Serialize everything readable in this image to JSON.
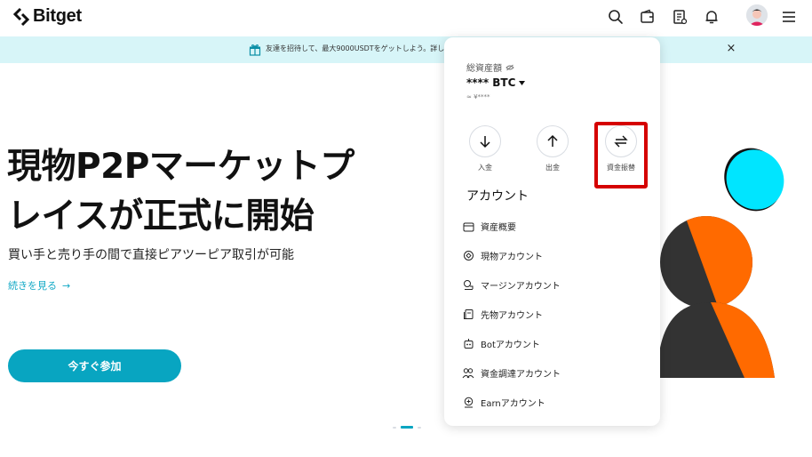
{
  "header": {
    "logo_text": "Bitget",
    "icons": [
      "search-icon",
      "wallet-icon",
      "orders-icon",
      "bell-icon",
      "avatar",
      "hamburger-icon"
    ]
  },
  "banner": {
    "text": "友達を招待して、最大9000USDTをゲットしよう。詳し",
    "close": "×"
  },
  "hero": {
    "title_line1": "現物P2Pマーケットプ",
    "title_line2": "レイスが正式に開始",
    "subtitle": "買い手と売り手の間で直接ピアツーピア取引が可能",
    "link_text": "続きを見る",
    "link_arrow": "→",
    "cta": "今すぐ参加"
  },
  "panel": {
    "total_label": "総資産額",
    "total_value": "**** BTC",
    "total_sub": "≈ ¥****",
    "actions": [
      {
        "label": "入金",
        "icon": "arrow-down-icon"
      },
      {
        "label": "出金",
        "icon": "arrow-up-icon"
      },
      {
        "label": "資金振替",
        "icon": "transfer-icon"
      }
    ],
    "account_title": "アカウント",
    "menu": [
      {
        "label": "資産概要",
        "icon": "wallet-outline-icon"
      },
      {
        "label": "現物アカウント",
        "icon": "spot-icon"
      },
      {
        "label": "マージンアカウント",
        "icon": "margin-icon"
      },
      {
        "label": "先物アカウント",
        "icon": "futures-icon"
      },
      {
        "label": "Botアカウント",
        "icon": "bot-icon"
      },
      {
        "label": "資金調達アカウント",
        "icon": "funding-icon"
      },
      {
        "label": "Earnアカウント",
        "icon": "earn-icon"
      }
    ]
  },
  "colors": {
    "accent": "#08a5c1",
    "banner_bg": "#d7f5f8",
    "highlight": "#d50000",
    "illus_orange": "#ff6a00",
    "illus_dark": "#333333",
    "illus_cyan": "#00e5ff"
  }
}
